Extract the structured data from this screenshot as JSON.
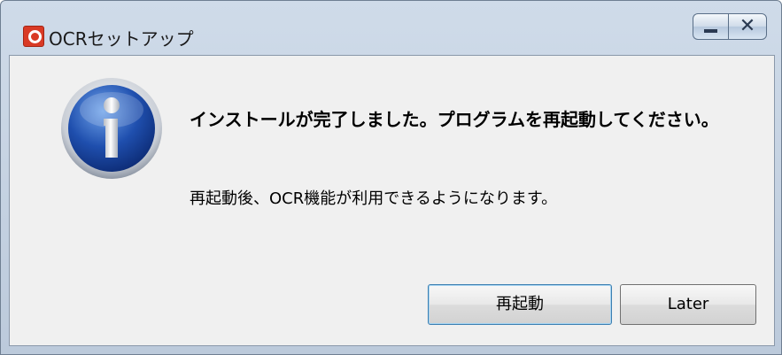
{
  "window": {
    "title": "OCRセットアップ",
    "icon": "app-logo-icon"
  },
  "caption_buttons": {
    "minimize_icon": "minimize-icon",
    "close_label": "✕"
  },
  "dialog": {
    "icon": "info-icon",
    "message": "インストールが完了しました。プログラムを再起動してください。",
    "detail": "再起動後、OCR機能が利用できるようになります。"
  },
  "buttons": {
    "restart": "再起動",
    "later": "Later"
  }
}
